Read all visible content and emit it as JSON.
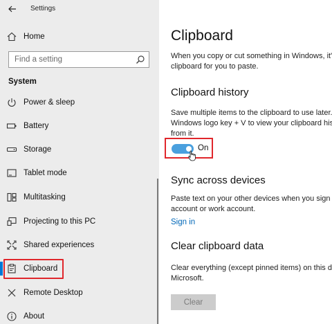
{
  "window": {
    "app_title": "Settings",
    "back_icon": "arrow-left-icon"
  },
  "nav": {
    "home": {
      "label": "Home",
      "icon": "home-icon"
    },
    "search": {
      "placeholder": "Find a setting",
      "icon": "search-icon"
    },
    "section": "System",
    "items": [
      {
        "label": "Power & sleep",
        "icon": "power-icon"
      },
      {
        "label": "Battery",
        "icon": "battery-icon"
      },
      {
        "label": "Storage",
        "icon": "storage-icon"
      },
      {
        "label": "Tablet mode",
        "icon": "tablet-icon"
      },
      {
        "label": "Multitasking",
        "icon": "multitasking-icon"
      },
      {
        "label": "Projecting to this PC",
        "icon": "projector-icon"
      },
      {
        "label": "Shared experiences",
        "icon": "shared-icon"
      },
      {
        "label": "Clipboard",
        "icon": "clipboard-icon",
        "selected": true
      },
      {
        "label": "Remote Desktop",
        "icon": "remote-desktop-icon"
      },
      {
        "label": "About",
        "icon": "info-icon"
      }
    ],
    "accent_color": "#0078d7",
    "highlight_color": "#e0262b"
  },
  "content": {
    "title": "Clipboard",
    "intro": [
      "When you copy or cut something in Windows, it's",
      "clipboard for you to paste."
    ],
    "history": {
      "heading": "Clipboard history",
      "desc": [
        "Save multiple items to the clipboard to use later.",
        "Windows logo key + V to view your clipboard his",
        "from it."
      ],
      "toggle_state": "On",
      "toggle_on": true
    },
    "sync": {
      "heading": "Sync across devices",
      "desc": [
        "Paste text on your other devices when you sign in",
        "account or work account."
      ],
      "link": "Sign in"
    },
    "clear": {
      "heading": "Clear clipboard data",
      "desc": [
        "Clear everything (except pinned items) on this de",
        "Microsoft."
      ],
      "button": "Clear"
    }
  }
}
